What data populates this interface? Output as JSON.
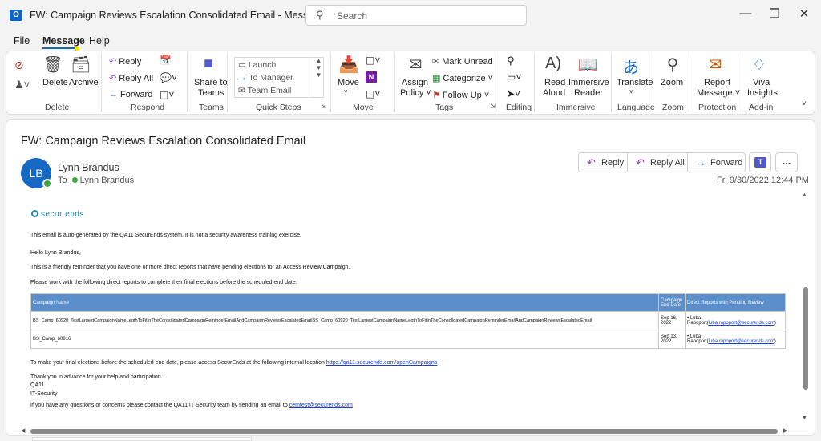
{
  "window": {
    "title": "FW: Campaign Reviews Escalation Consolidated Email  -  Message (HTML)",
    "search_placeholder": "Search",
    "app_icon_letter": "O"
  },
  "menu": {
    "file": "File",
    "message": "Message",
    "help": "Help"
  },
  "ribbon": {
    "delete_group": {
      "delete": "Delete",
      "archive": "Archive",
      "label": "Delete"
    },
    "respond_group": {
      "reply": "Reply",
      "reply_all": "Reply All",
      "forward": "Forward",
      "label": "Respond"
    },
    "teams_group": {
      "share_line1": "Share to",
      "share_line2": "Teams",
      "label": "Teams"
    },
    "quick_steps": {
      "items": [
        "Launch",
        "To Manager",
        "Team Email"
      ],
      "label": "Quick Steps"
    },
    "move_group": {
      "move": "Move",
      "label": "Move"
    },
    "tags_group": {
      "assign_line1": "Assign",
      "assign_line2": "Policy",
      "mark_unread": "Mark Unread",
      "categorize": "Categorize",
      "follow_up": "Follow Up",
      "label": "Tags"
    },
    "editing_group": {
      "label": "Editing"
    },
    "immersive_group": {
      "read_line1": "Read",
      "read_line2": "Aloud",
      "reader_line1": "Immersive",
      "reader_line2": "Reader",
      "label": "Immersive"
    },
    "language_group": {
      "translate": "Translate",
      "label": "Language"
    },
    "zoom_group": {
      "zoom": "Zoom",
      "label": "Zoom"
    },
    "protection_group": {
      "report_line1": "Report",
      "report_line2": "Message",
      "label": "Protection"
    },
    "addin_group": {
      "viva_line1": "Viva",
      "viva_line2": "Insights",
      "label": "Add-in"
    }
  },
  "message": {
    "subject": "FW: Campaign Reviews Escalation Consolidated Email",
    "sender_initials": "LB",
    "sender_name": "Lynn Brandus",
    "to_label": "To",
    "to_name": "Lynn Brandus",
    "date": "Fri 9/30/2022 12:44 PM",
    "actions": {
      "reply": "Reply",
      "reply_all": "Reply All",
      "forward": "Forward",
      "more": "..."
    }
  },
  "body": {
    "logo_text": "secur ends",
    "line_autogen": "This email is auto-generated by the QA11 SecurEnds system. It is not a security awareness training exercise.",
    "greeting": "Hello Lynn Brandus,",
    "line_reminder": "This is a friendly reminder that you have one or more direct reports that have pending elections for an Access Review Campaign.",
    "line_work": "Please work with the following direct reports to complete their final elections before the scheduled end date.",
    "table": {
      "headers": [
        "Campaign Name",
        "Campaign End Date",
        "Direct Reports with Pending Review"
      ],
      "rows": [
        {
          "name": "BS_Camp_60920_TestLargestCampaignNameLegthToFitInTheConsolidatedCampaignReminderEmailAndCampaignReviewsEscalatedEmailBS_Camp_60920_TestLargestCampaignNameLegthToFitInTheConsolidatedCampaignReminderEmailAndCampaignReviewsEscalatedEmail",
          "date": "Sep 16, 2022",
          "reviewer": "Luba Rapoport",
          "email": "luba.rapoport@securends.com"
        },
        {
          "name": "BS_Camp_60916",
          "date": "Sep 13, 2022",
          "reviewer": "Luba Rapoport",
          "email": "luba.rapoport@securends.com"
        }
      ]
    },
    "line_access": "To make your final elections before the scheduled end date, please access SecurEnds at the following internal location",
    "access_link": "https://qa11.securends.com/openCampaigns",
    "thanks": "Thank you in advance for your help and participation.",
    "sig1": "QA11",
    "sig2": "IT-Security",
    "line_contact": "If you have any questions or concerns please contact the QA11 IT Security team by sending an email to",
    "contact_email": "cemtest@securends.com"
  },
  "colors": {
    "accent": "#0f6cbd",
    "table_header": "#5a8fcc",
    "avatar": "#1568c4",
    "presence": "#3fa43f"
  }
}
